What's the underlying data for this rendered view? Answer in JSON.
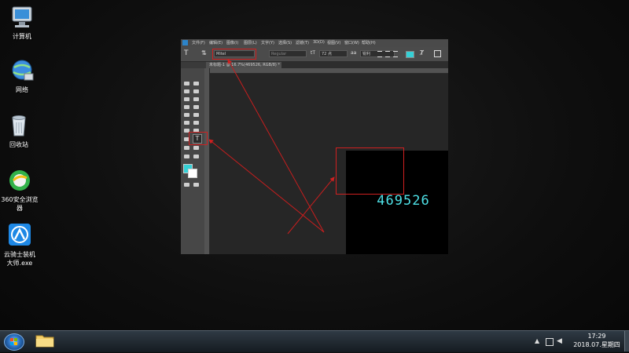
{
  "desktop": {
    "icons": [
      {
        "label": "计算机",
        "icon": "computer-icon"
      },
      {
        "label": "网络",
        "icon": "network-icon"
      },
      {
        "label": "回收站",
        "icon": "recycle-bin-icon"
      },
      {
        "label": "360安全浏览\n器",
        "icon": "360-browser-icon"
      },
      {
        "label": "云骑士装机\n大师.exe",
        "icon": "yunqishi-installer-icon"
      }
    ]
  },
  "photoshop": {
    "menu": [
      "文件(F)",
      "编辑(E)",
      "图像(I)",
      "图层(L)",
      "文字(Y)",
      "选择(S)",
      "滤镜(T)",
      "3D(D)",
      "视图(V)",
      "窗口(W)",
      "帮助(H)"
    ],
    "options": {
      "font_family": "Mitel",
      "font_style": "Regular",
      "font_size": "72 点",
      "antialias": "锐利"
    },
    "doc_tab": "未标题-1 @ 16.7%(469526, RGB/8) *",
    "canvas_text": "469526",
    "colors": {
      "text": "#4ee0e6",
      "annotation": "#d02020",
      "foreground_swatch": "#35d0d6"
    }
  },
  "taskbar": {
    "time": "17:29",
    "date": "2018.07.星期四"
  }
}
